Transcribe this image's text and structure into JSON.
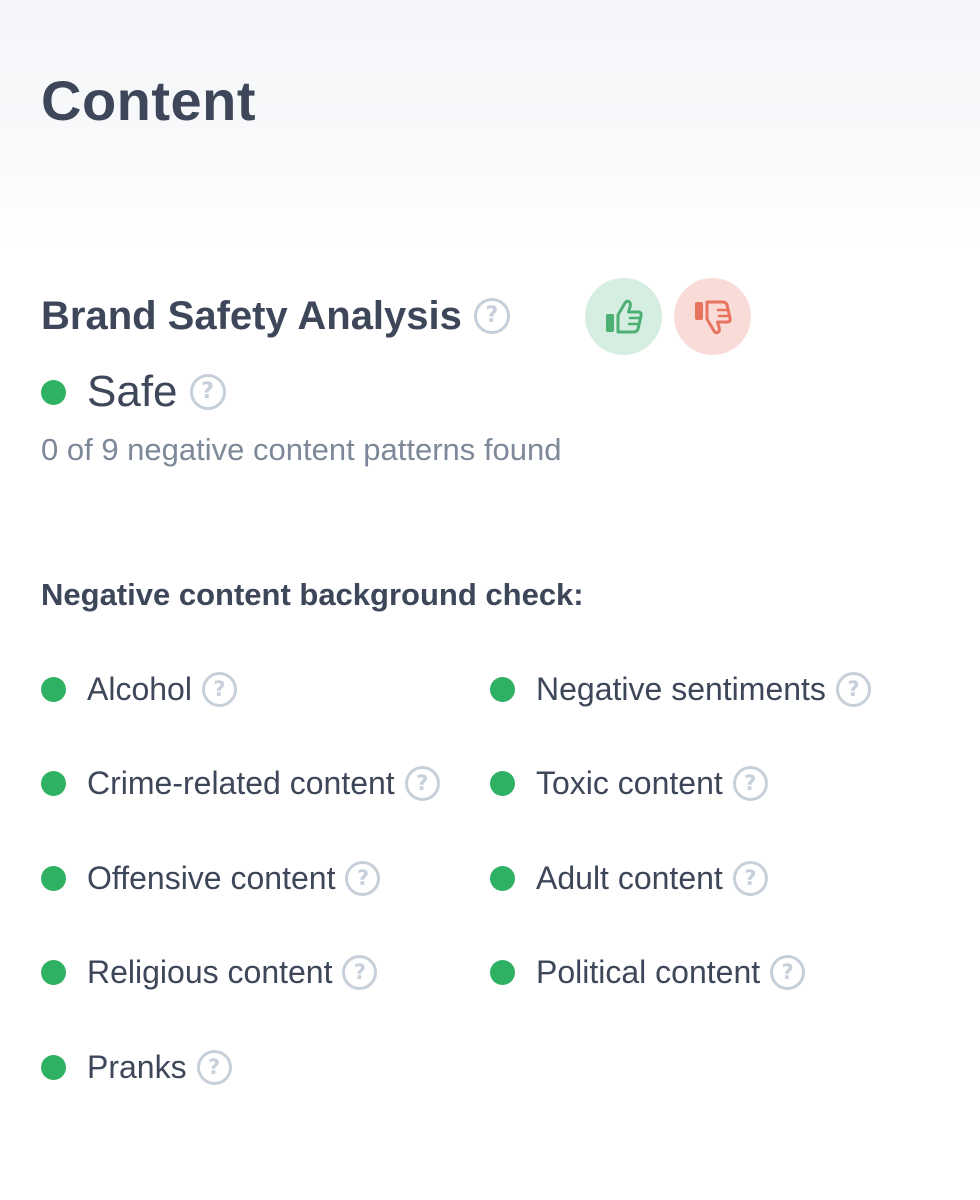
{
  "page": {
    "title": "Content"
  },
  "brand_safety": {
    "title": "Brand Safety Analysis",
    "help_icon": "question-circle-icon",
    "vote_up_icon": "thumbs-up-icon",
    "vote_down_icon": "thumbs-down-icon",
    "status": {
      "label": "Safe",
      "color": "#2fb163"
    },
    "summary": "0 of 9 negative content patterns found"
  },
  "background_check": {
    "heading": "Negative content background check:",
    "items": [
      {
        "label": "Alcohol",
        "status_color": "#2fb163"
      },
      {
        "label": "Negative sentiments",
        "status_color": "#2fb163"
      },
      {
        "label": "Crime-related content",
        "status_color": "#2fb163"
      },
      {
        "label": "Toxic content",
        "status_color": "#2fb163"
      },
      {
        "label": "Offensive content",
        "status_color": "#2fb163"
      },
      {
        "label": "Adult content",
        "status_color": "#2fb163"
      },
      {
        "label": "Religious content",
        "status_color": "#2fb163"
      },
      {
        "label": "Political content",
        "status_color": "#2fb163"
      },
      {
        "label": "Pranks",
        "status_color": "#2fb163"
      }
    ]
  },
  "colors": {
    "safe": "#2fb163",
    "vote_up_bg": "#d6ede1",
    "vote_up_fg": "#4caf74",
    "vote_down_bg": "#f9dcd8",
    "vote_down_fg": "#e8735f",
    "heading": "#3d4759",
    "muted": "#7d8899",
    "help": "#c7d0da"
  }
}
